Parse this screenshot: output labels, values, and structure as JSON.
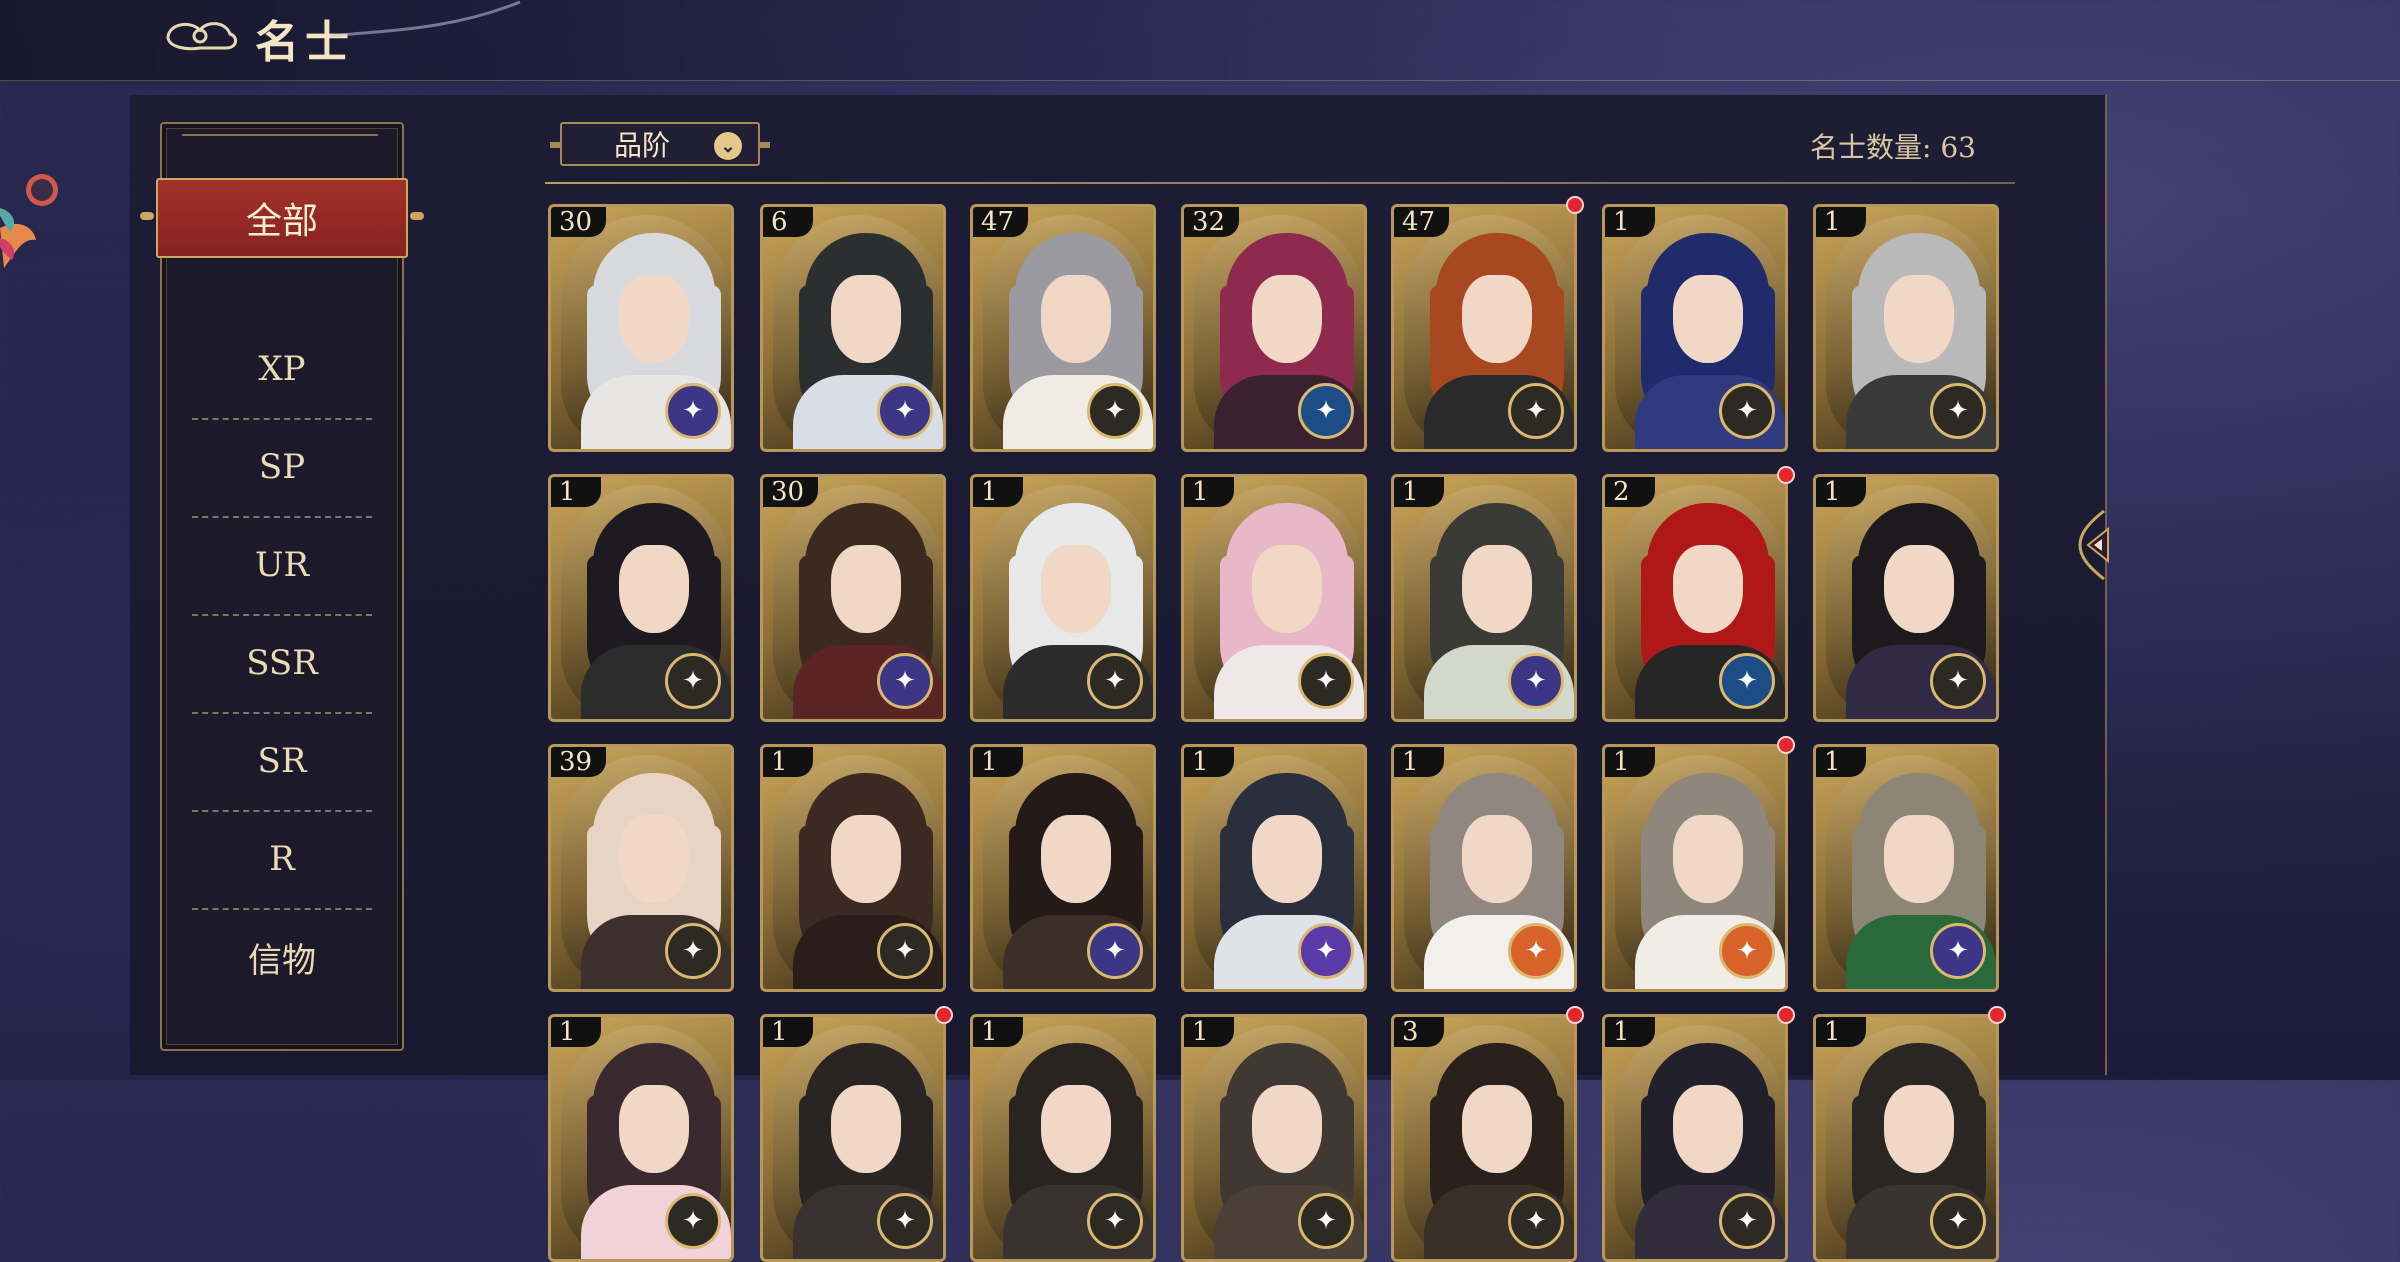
{
  "header": {
    "title": "名士"
  },
  "sidebar": {
    "items": [
      {
        "label": "全部",
        "active": true
      },
      {
        "label": "XP"
      },
      {
        "label": "SP"
      },
      {
        "label": "UR"
      },
      {
        "label": "SSR"
      },
      {
        "label": "SR"
      },
      {
        "label": "R"
      },
      {
        "label": "信物"
      }
    ]
  },
  "filter": {
    "dropdown_label": "品阶",
    "count_label": "名士数量: 63"
  },
  "cards": [
    {
      "level": "30",
      "badge": "purple",
      "red_dot": false,
      "hair": "#d8d9dd",
      "robe": "#e8e6e2"
    },
    {
      "level": "6",
      "badge": "purple",
      "red_dot": false,
      "hair": "#2c2f30",
      "robe": "#d9dde6"
    },
    {
      "level": "47",
      "badge": "gold",
      "red_dot": false,
      "hair": "#9c9aa1",
      "robe": "#f0ece4"
    },
    {
      "level": "32",
      "badge": "blue",
      "red_dot": false,
      "hair": "#8d2a4e",
      "robe": "#3b2030"
    },
    {
      "level": "47",
      "badge": "gold",
      "red_dot": true,
      "hair": "#a84820",
      "robe": "#2a2a2a"
    },
    {
      "level": "1",
      "badge": "gold",
      "red_dot": false,
      "hair": "#1f2b6a",
      "robe": "#2f3a80"
    },
    {
      "level": "1",
      "badge": "gold",
      "red_dot": false,
      "hair": "#b9b9b9",
      "robe": "#3a3a3a"
    },
    {
      "level": "1",
      "badge": "gold",
      "red_dot": false,
      "hair": "#1e1a22",
      "robe": "#2c2c2c"
    },
    {
      "level": "30",
      "badge": "purple",
      "red_dot": false,
      "hair": "#3a2a1f",
      "robe": "#5b2525"
    },
    {
      "level": "1",
      "badge": "gold",
      "red_dot": false,
      "hair": "#e8e8e8",
      "robe": "#2b2b2b"
    },
    {
      "level": "1",
      "badge": "gold",
      "red_dot": false,
      "hair": "#e8b8c8",
      "robe": "#efe8e8"
    },
    {
      "level": "1",
      "badge": "purple",
      "red_dot": false,
      "hair": "#3a3a36",
      "robe": "#d3d8cc"
    },
    {
      "level": "2",
      "badge": "blue",
      "red_dot": true,
      "hair": "#b01818",
      "robe": "#262626"
    },
    {
      "level": "1",
      "badge": "gold",
      "red_dot": false,
      "hair": "#1c1a1c",
      "robe": "#302a44"
    },
    {
      "level": "39",
      "badge": "gold",
      "red_dot": false,
      "hair": "#e8d4c4",
      "robe": "#3b302c"
    },
    {
      "level": "1",
      "badge": "gold",
      "red_dot": false,
      "hair": "#3a2a22",
      "robe": "#2a1e1a"
    },
    {
      "level": "1",
      "badge": "purple",
      "red_dot": false,
      "hair": "#241a18",
      "robe": "#3c2f28"
    },
    {
      "level": "1",
      "badge": "galaxy",
      "red_dot": false,
      "hair": "#2a2f3e",
      "robe": "#e0e2ea"
    },
    {
      "level": "1",
      "badge": "orange",
      "red_dot": false,
      "hair": "#8f8780",
      "robe": "#f2f0ec"
    },
    {
      "level": "1",
      "badge": "orange",
      "red_dot": true,
      "hair": "#8f877c",
      "robe": "#f0ede6"
    },
    {
      "level": "1",
      "badge": "purple",
      "red_dot": false,
      "hair": "#8d8677",
      "robe": "#2a6a3a"
    },
    {
      "level": "1",
      "badge": "gold",
      "red_dot": false,
      "hair": "#3a2a30",
      "robe": "#f1d2d8"
    },
    {
      "level": "1",
      "badge": "gold",
      "red_dot": true,
      "hair": "#2a2424",
      "robe": "#3a3230"
    },
    {
      "level": "1",
      "badge": "gold",
      "red_dot": false,
      "hair": "#2a2420",
      "robe": "#3a3230"
    },
    {
      "level": "1",
      "badge": "gold",
      "red_dot": false,
      "hair": "#403832",
      "robe": "#4a4036"
    },
    {
      "level": "3",
      "badge": "gold",
      "red_dot": true,
      "hair": "#2a201c",
      "robe": "#3a302a"
    },
    {
      "level": "1",
      "badge": "gold",
      "red_dot": true,
      "hair": "#22202a",
      "robe": "#302c3a"
    },
    {
      "level": "1",
      "badge": "gold",
      "red_dot": true,
      "hair": "#2a2624",
      "robe": "#3a3430"
    }
  ],
  "colors": {
    "badge_gold": "#2d2a24",
    "badge_purple": "#3d3585",
    "badge_blue": "#1d4d86",
    "badge_orange": "#d8622a",
    "badge_galaxy": "#5a3aa8",
    "accent_red": "#9c2b26",
    "frame_gold": "#b8975a"
  }
}
